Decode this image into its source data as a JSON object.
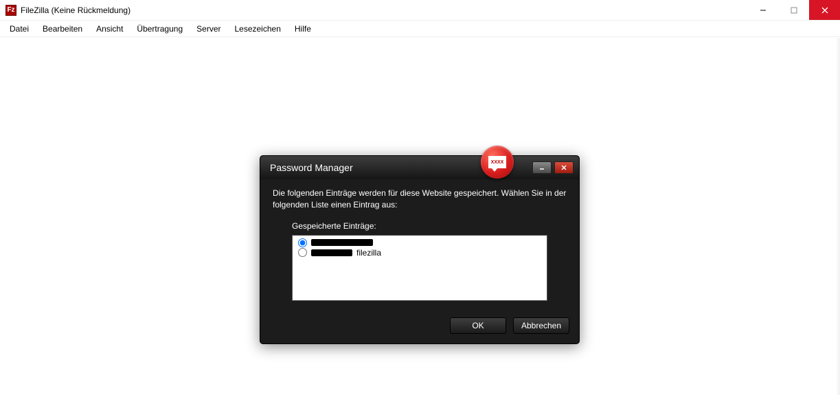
{
  "window": {
    "title": "FileZilla (Keine Rückmeldung)",
    "icon_letters": "Fz"
  },
  "menu": {
    "items": [
      "Datei",
      "Bearbeiten",
      "Ansicht",
      "Übertragung",
      "Server",
      "Lesezeichen",
      "Hilfe"
    ]
  },
  "dialog": {
    "title": "Password Manager",
    "description": "Die folgenden Einträge werden für diese Website gespeichert. Wählen Sie in der folgenden Liste einen Eintrag aus:",
    "list_label": "Gespeicherte Einträge:",
    "entries": [
      {
        "text_suffix": "",
        "selected": true
      },
      {
        "text_suffix": "filezilla",
        "selected": false
      }
    ],
    "buttons": {
      "ok": "OK",
      "cancel": "Abbrechen"
    },
    "badge_text": "XXXX"
  }
}
